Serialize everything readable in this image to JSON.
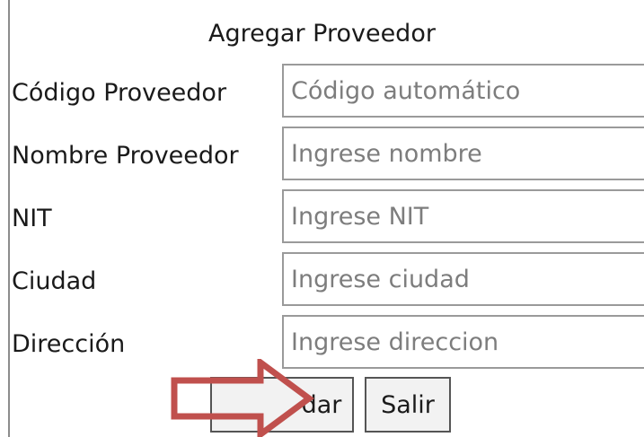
{
  "form": {
    "title": "Agregar Proveedor",
    "fields": [
      {
        "label": "Código Proveedor",
        "placeholder": "Código automático",
        "value": ""
      },
      {
        "label": "Nombre Proveedor",
        "placeholder": "Ingrese nombre",
        "value": ""
      },
      {
        "label": "NIT",
        "placeholder": "Ingrese NIT",
        "value": ""
      },
      {
        "label": "Ciudad",
        "placeholder": "Ingrese ciudad",
        "value": ""
      },
      {
        "label": "Dirección",
        "placeholder": "Ingrese direccion",
        "value": ""
      }
    ],
    "buttons": {
      "save_label": "dar",
      "exit_label": "Salir"
    }
  },
  "annotation": {
    "arrow_icon": "right-arrow-icon",
    "arrow_color": "#c0504d"
  }
}
